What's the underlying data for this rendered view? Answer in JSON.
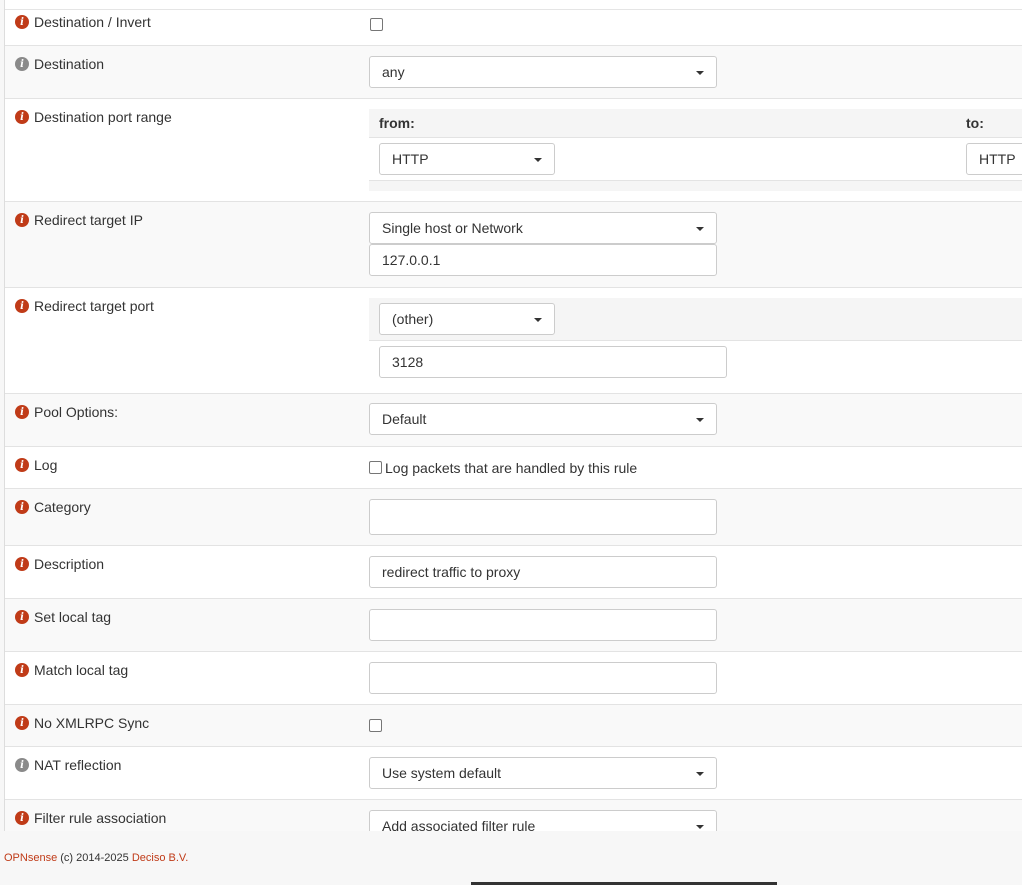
{
  "rows": {
    "destination_invert": {
      "label": "Destination / Invert"
    },
    "destination": {
      "label": "Destination",
      "value": "any"
    },
    "destination_port_range": {
      "label": "Destination port range",
      "from_label": "from:",
      "to_label": "to:",
      "from_value": "HTTP",
      "to_value": "HTTP"
    },
    "redirect_target_ip": {
      "label": "Redirect target IP",
      "type_value": "Single host or Network",
      "ip_value": "127.0.0.1"
    },
    "redirect_target_port": {
      "label": "Redirect target port",
      "select_value": "(other)",
      "port_value": "3128"
    },
    "pool_options": {
      "label": "Pool Options:",
      "value": "Default"
    },
    "log": {
      "label": "Log",
      "checkbox_text": "Log packets that are handled by this rule"
    },
    "category": {
      "label": "Category",
      "value": ""
    },
    "description": {
      "label": "Description",
      "value": "redirect traffic to proxy"
    },
    "set_local_tag": {
      "label": "Set local tag",
      "value": ""
    },
    "match_local_tag": {
      "label": "Match local tag",
      "value": ""
    },
    "no_xmlrpc_sync": {
      "label": "No XMLRPC Sync"
    },
    "nat_reflection": {
      "label": "NAT reflection",
      "value": "Use system default"
    },
    "filter_rule_association": {
      "label": "Filter rule association",
      "value": "Add associated filter rule"
    }
  },
  "footer": {
    "brand": "OPNsense",
    "copyright": " (c) 2014-2025 ",
    "company": "Deciso B.V."
  },
  "colors": {
    "accent": "#c03b18",
    "info_grey": "#8a8a8a"
  }
}
